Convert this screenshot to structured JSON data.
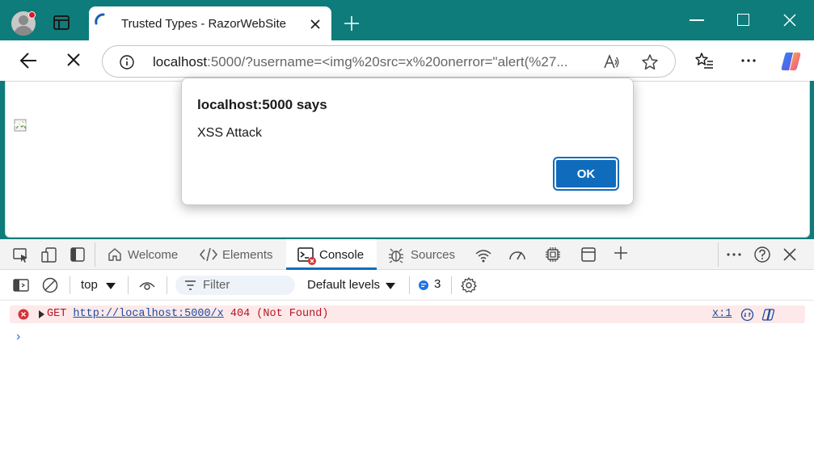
{
  "browser": {
    "tab_title": "Trusted Types - RazorWebSite",
    "address": {
      "host": "localhost",
      "rest": ":5000/?username=<img%20src=x%20onerror=\"alert(%27..."
    }
  },
  "dialog": {
    "title": "localhost:5000 says",
    "message": "XSS Attack",
    "ok_label": "OK"
  },
  "devtools": {
    "tabs": [
      {
        "label": "Welcome"
      },
      {
        "label": "Elements"
      },
      {
        "label": "Console"
      },
      {
        "label": "Sources"
      }
    ],
    "console_bar": {
      "context": "top",
      "filter_placeholder": "Filter",
      "levels": "Default levels",
      "issues_count": "3"
    },
    "log": {
      "method": "GET",
      "url": "http://localhost:5000/x",
      "status": "404 (Not Found)",
      "source": "x:1"
    },
    "prompt": "›"
  },
  "colors": {
    "titlebar": "#0e7c7b",
    "accent": "#0f6cbd",
    "error_bg": "#fde9e9",
    "error_text": "#b5172a"
  }
}
